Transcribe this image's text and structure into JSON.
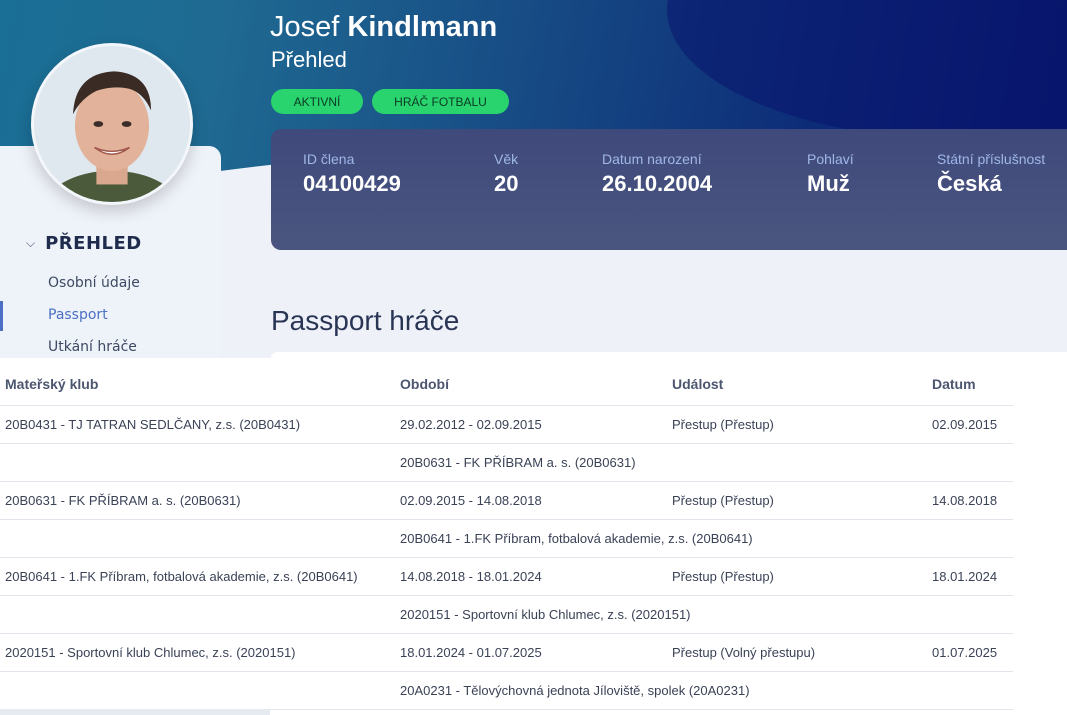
{
  "profile": {
    "first_name": "Josef",
    "last_name": "Kindlmann",
    "subtitle": "Přehled",
    "badges": [
      "AKTIVNÍ",
      "HRÁČ FOTBALU"
    ]
  },
  "info": [
    {
      "label": "ID člena",
      "value": "04100429"
    },
    {
      "label": "Věk",
      "value": "20"
    },
    {
      "label": "Datum narození",
      "value": "26.10.2004"
    },
    {
      "label": "Pohlaví",
      "value": "Muž"
    },
    {
      "label": "Státní příslušnost",
      "value": "Česká"
    }
  ],
  "sidebar": {
    "section": "PŘEHLED",
    "items": [
      {
        "label": "Osobní údaje"
      },
      {
        "label": "Passport"
      },
      {
        "label": "Utkání hráče"
      }
    ]
  },
  "passport": {
    "title": "Passport hráče",
    "columns": [
      "Mateřský klub",
      "Období",
      "Událost",
      "Datum"
    ],
    "rows": [
      {
        "club": "20B0431 - TJ TATRAN SEDLČANY, z.s. (20B0431)",
        "period": "29.02.2012 - 02.09.2015",
        "event": "Přestup (Přestup)",
        "date": "02.09.2015"
      },
      {
        "club": "",
        "period": "20B0631 - FK PŘÍBRAM a. s. (20B0631)",
        "event": "",
        "date": ""
      },
      {
        "club": "20B0631 - FK PŘÍBRAM a. s. (20B0631)",
        "period": "02.09.2015 - 14.08.2018",
        "event": "Přestup (Přestup)",
        "date": "14.08.2018"
      },
      {
        "club": "",
        "period": "20B0641 - 1.FK Příbram, fotbalová akademie, z.s. (20B0641)",
        "event": "",
        "date": ""
      },
      {
        "club": "20B0641 - 1.FK Příbram, fotbalová akademie, z.s. (20B0641)",
        "period": "14.08.2018 - 18.01.2024",
        "event": "Přestup (Přestup)",
        "date": "18.01.2024"
      },
      {
        "club": "",
        "period": "2020151 - Sportovní klub Chlumec, z.s. (2020151)",
        "event": "",
        "date": ""
      },
      {
        "club": "2020151 - Sportovní klub Chlumec, z.s. (2020151)",
        "period": "18.01.2024 - 01.07.2025",
        "event": "Přestup (Volný přestupu)",
        "date": "01.07.2025"
      },
      {
        "club": "",
        "period": "20A0231 - Tělovýchovná jednota Jíloviště, spolek (20A0231)",
        "event": "",
        "date": ""
      }
    ]
  },
  "colors": {
    "badge_green": "#29d36e",
    "accent_blue": "#4a6fc4",
    "info_card": "#434e7e"
  }
}
